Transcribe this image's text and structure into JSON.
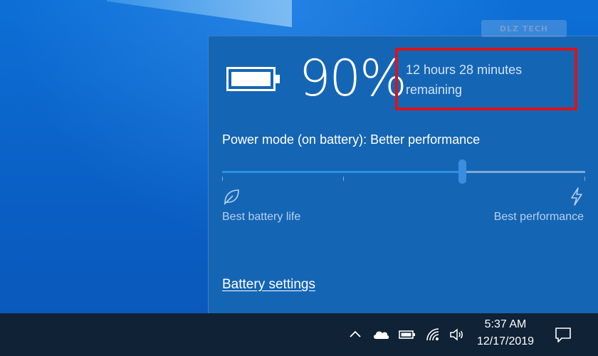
{
  "watermark": {
    "text": "DLZ TECH"
  },
  "battery": {
    "icon": "battery-full-icon",
    "percent": "90%",
    "level": 0.9,
    "remaining_line1": "12 hours 28 minutes",
    "remaining_line2": "remaining",
    "highlight_color": "#d9141b"
  },
  "power_mode": {
    "title": "Power mode (on battery): Better performance",
    "slider_value_fraction": 0.66,
    "left_label": "Best battery life",
    "right_label": "Best performance",
    "left_icon": "leaf-icon",
    "right_icon": "lightning-bolt-icon"
  },
  "links": {
    "battery_settings": "Battery settings"
  },
  "taskbar": {
    "tray_icons": [
      "chevron-up-icon",
      "onedrive-cloud-icon",
      "battery-icon",
      "wifi-icon",
      "volume-icon"
    ],
    "time": "5:37 AM",
    "date": "12/17/2019",
    "notification_icon": "action-center-icon"
  },
  "colors": {
    "flyout_bg": "#1565b5",
    "taskbar_bg": "#0f2236",
    "accent": "#2b8fe8"
  }
}
